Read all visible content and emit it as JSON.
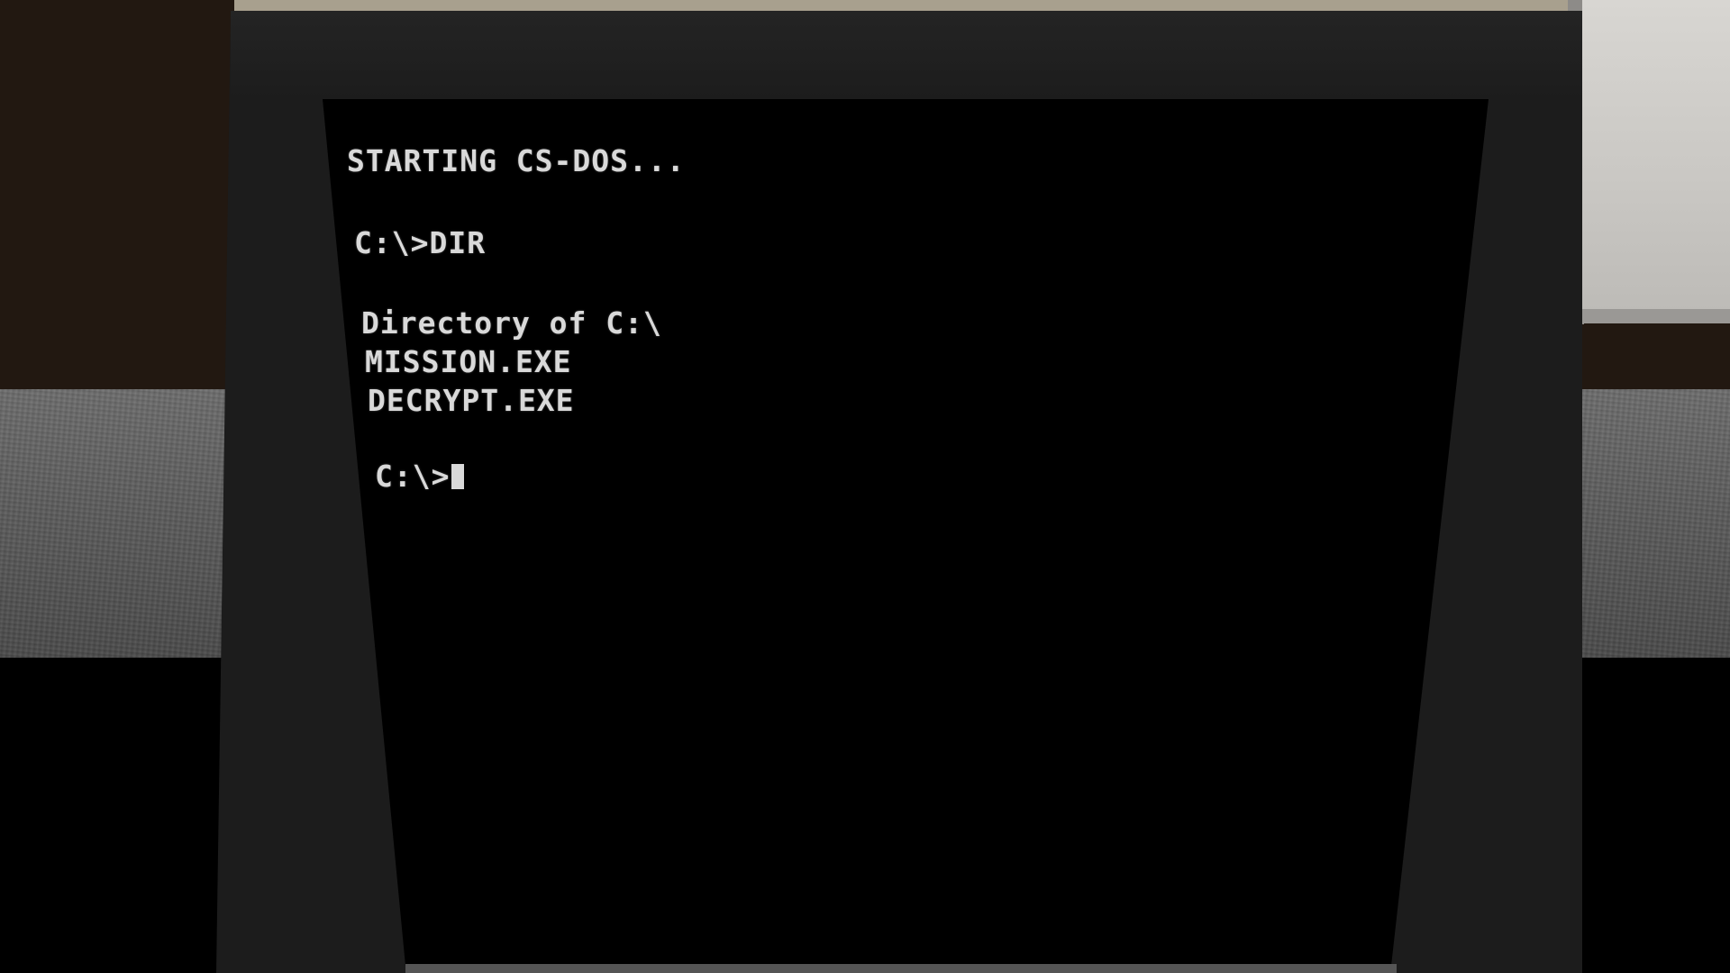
{
  "terminal": {
    "boot_message": "STARTING CS-DOS...",
    "command_prompt": "C:\\>DIR",
    "directory_header": "Directory of C:\\",
    "files": [
      "MISSION.EXE",
      "DECRYPT.EXE"
    ],
    "current_prompt": "C:\\>",
    "cursor_glyph": "block-cursor-icon"
  },
  "colors": {
    "text": "#d9d9d9",
    "screen": "#000000",
    "bezel": "#1c1c1c"
  }
}
